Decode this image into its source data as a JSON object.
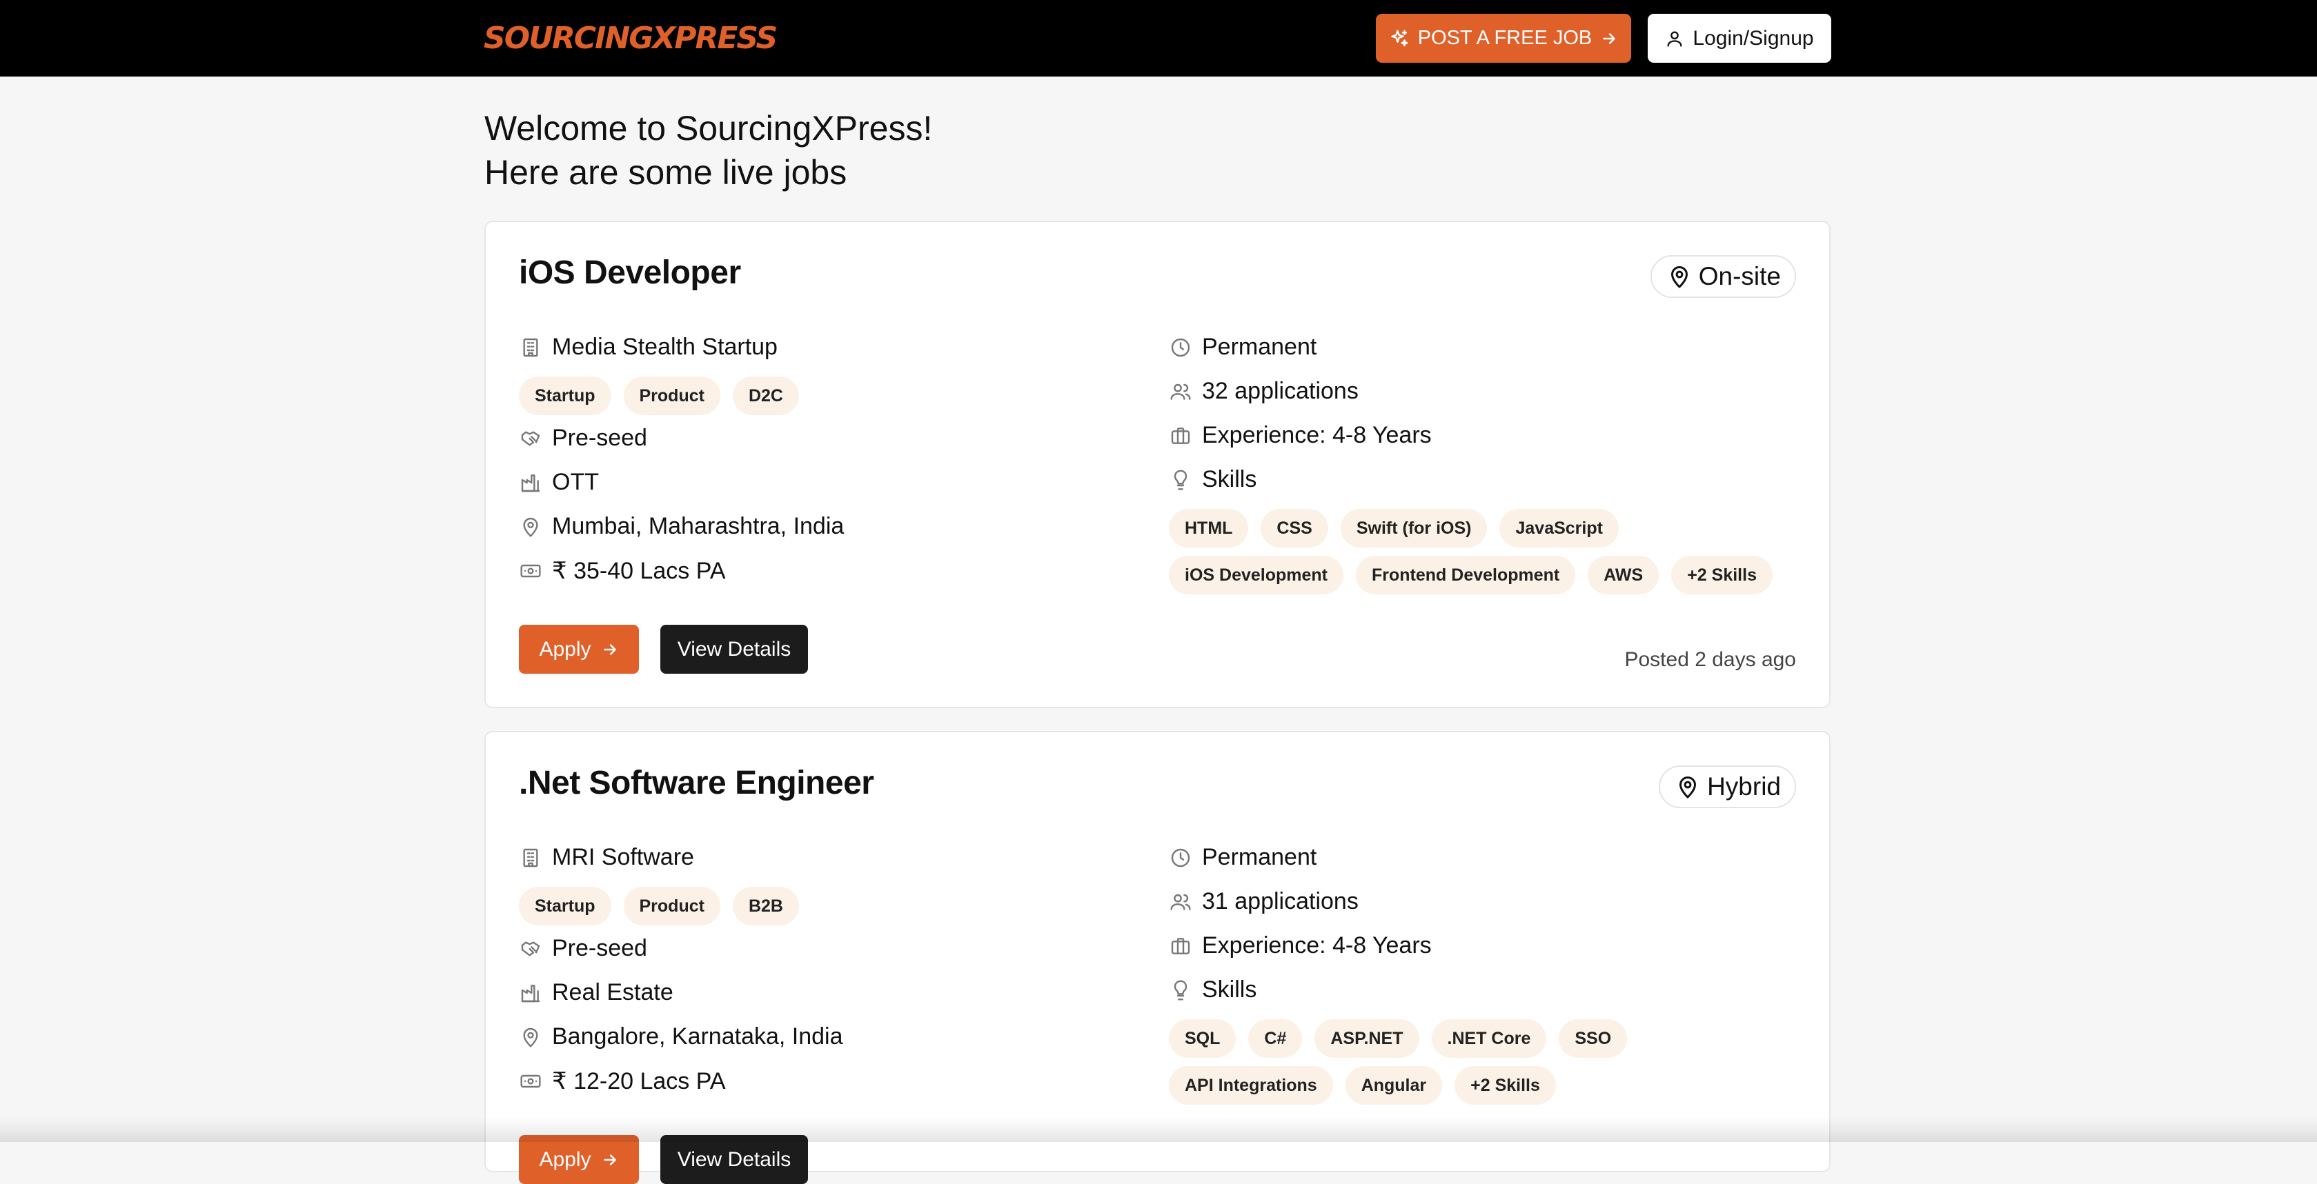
{
  "header": {
    "logo_text": "SOURCINGXPRESS",
    "post_job_label": "POST A FREE JOB",
    "login_label": "Login/Signup",
    "accent_color": "#e0602a"
  },
  "welcome": {
    "line1": "Welcome to SourcingXPress!",
    "line2": "Here are some live jobs"
  },
  "jobs": [
    {
      "title": "iOS Developer",
      "work_mode": "On-site",
      "company": "Media Stealth Startup",
      "company_tags": [
        "Startup",
        "Product",
        "D2C"
      ],
      "funding_stage": "Pre-seed",
      "industry": "OTT",
      "location": "Mumbai, Maharashtra, India",
      "salary": "₹ 35-40 Lacs PA",
      "employment_type": "Permanent",
      "applications": "32 applications",
      "experience": "Experience: 4-8 Years",
      "skills_label": "Skills",
      "skills": [
        "HTML",
        "CSS",
        "Swift (for iOS)",
        "JavaScript",
        "iOS Development",
        "Frontend Development",
        "AWS",
        "+2 Skills"
      ],
      "apply_label": "Apply",
      "view_label": "View Details",
      "posted": "Posted 2 days ago"
    },
    {
      "title": ".Net Software Engineer",
      "work_mode": "Hybrid",
      "company": "MRI Software",
      "company_tags": [
        "Startup",
        "Product",
        "B2B"
      ],
      "funding_stage": "Pre-seed",
      "industry": "Real Estate",
      "location": "Bangalore, Karnataka, India",
      "salary": "₹ 12-20 Lacs PA",
      "employment_type": "Permanent",
      "applications": "31 applications",
      "experience": "Experience: 4-8 Years",
      "skills_label": "Skills",
      "skills": [
        "SQL",
        "C#",
        "ASP.NET",
        ".NET Core",
        "SSO",
        "API Integrations",
        "Angular",
        "+2 Skills"
      ],
      "apply_label": "Apply",
      "view_label": "View Details"
    }
  ],
  "icons": {
    "post_job": "sparkles-icon",
    "arrow": "arrow-right-icon",
    "user": "user-icon",
    "map_pin": "map-pin-icon",
    "company": "building-icon",
    "funding": "handshake-icon",
    "industry": "factory-icon",
    "salary": "banknote-icon",
    "clock": "clock-icon",
    "applicants": "users-icon",
    "experience": "briefcase-icon",
    "skills": "lightbulb-icon"
  }
}
